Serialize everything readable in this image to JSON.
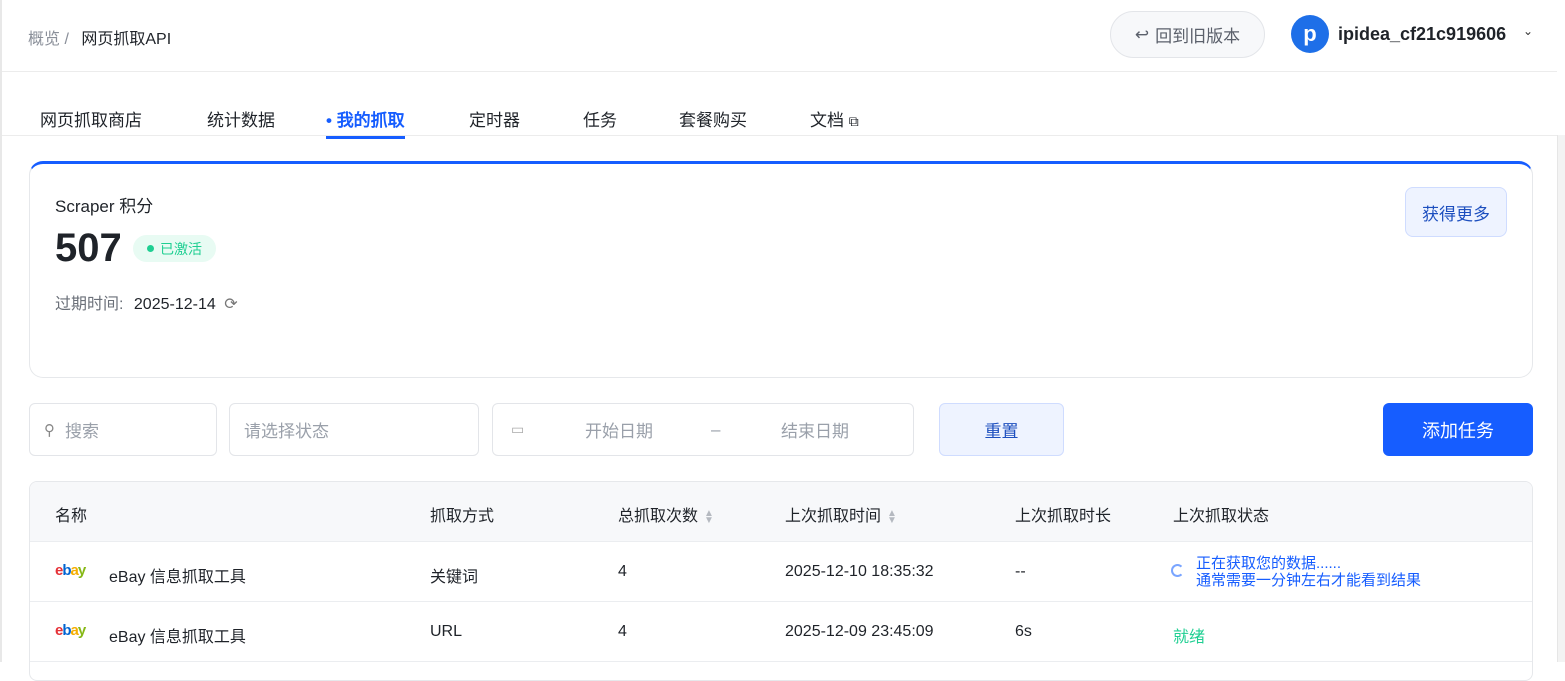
{
  "breadcrumb": {
    "parent": "概览",
    "sep": "/",
    "current": "网页抓取API"
  },
  "header": {
    "back_label": "回到旧版本",
    "username": "ipidea_cf21c919606",
    "avatar_letter": "p"
  },
  "tabs": [
    {
      "label": "网页抓取商店"
    },
    {
      "label": "统计数据"
    },
    {
      "label": "我的抓取"
    },
    {
      "label": "定时器"
    },
    {
      "label": "任务"
    },
    {
      "label": "套餐购买"
    },
    {
      "label": "文档"
    }
  ],
  "card": {
    "title": "Scraper 积分",
    "points": "507",
    "status": "已激活",
    "expire_label": "过期时间:",
    "expire_date": "2025-12-14",
    "more_label": "获得更多"
  },
  "filters": {
    "search_placeholder": "搜索",
    "status_placeholder": "请选择状态",
    "start_placeholder": "开始日期",
    "range_sep": "–",
    "end_placeholder": "结束日期",
    "reset_label": "重置",
    "add_label": "添加任务"
  },
  "table": {
    "headers": [
      "名称",
      "抓取方式",
      "总抓取次数",
      "上次抓取时间",
      "上次抓取时长",
      "上次抓取状态"
    ],
    "rows": [
      {
        "logo": "ebay",
        "name": "eBay 信息抓取工具",
        "method": "关键词",
        "count": "4",
        "time": "2025-12-10 18:35:32",
        "duration": "--",
        "status_line1": "正在获取您的数据......",
        "status_line2": "通常需要一分钟左右才能看到结果"
      },
      {
        "logo": "ebay",
        "name": "eBay 信息抓取工具",
        "method": "URL",
        "count": "4",
        "time": "2025-12-09 23:45:09",
        "duration": "6s",
        "status": "就绪"
      }
    ]
  },
  "colors": {
    "accent": "#165dff",
    "success": "#1fcf92"
  }
}
